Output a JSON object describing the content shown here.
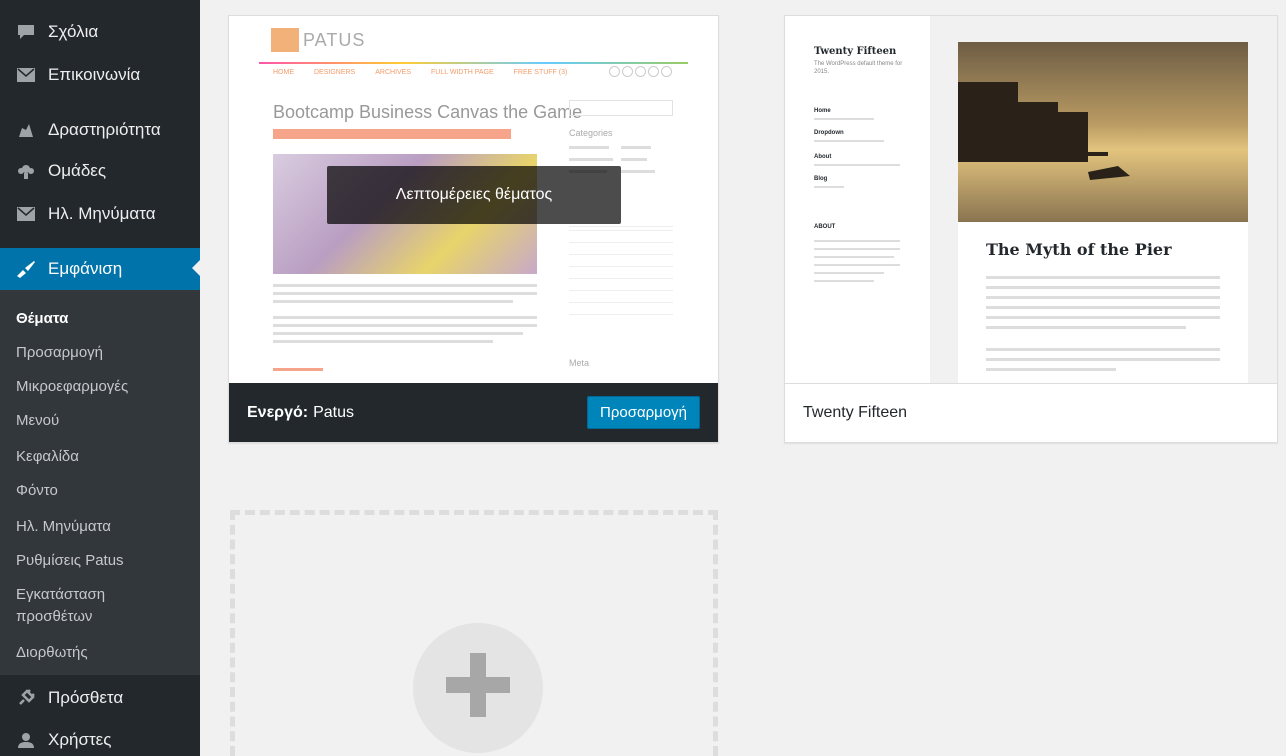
{
  "sidebar": {
    "items": [
      {
        "label": "Σχόλια",
        "icon": "comment-icon"
      },
      {
        "label": "Επικοινωνία",
        "icon": "mail-icon"
      },
      {
        "label": "Δραστηριότητα",
        "icon": "activity-icon"
      },
      {
        "label": "Ομάδες",
        "icon": "groups-icon"
      },
      {
        "label": "Ηλ. Μηνύματα",
        "icon": "mail-icon"
      },
      {
        "label": "Εμφάνιση",
        "icon": "brush-icon",
        "active": true
      },
      {
        "label": "Πρόσθετα",
        "icon": "plugins-icon"
      },
      {
        "label": "Χρήστες",
        "icon": "users-icon"
      }
    ],
    "submenu": [
      "Θέματα",
      "Προσαρμογή",
      "Μικροεφαρμογές",
      "Μενού",
      "Κεφαλίδα",
      "Φόντο",
      "Ηλ. Μηνύματα",
      "Ρυθμίσεις Patus",
      "Εγκατάσταση",
      "προσθέτων",
      "Διορθωτής"
    ]
  },
  "themes": {
    "patus": {
      "active_prefix": "Ενεργό:",
      "name": "Patus",
      "customize_label": "Προσαρμογή",
      "details_label": "Λεπτομέρειες θέματος",
      "preview": {
        "logo": "PATUS",
        "post_title": "Bootcamp Business Canvas the Game",
        "nav": [
          "HOME",
          "DESIGNERS",
          "ARCHIVES",
          "FULL WIDTH PAGE",
          "FREE STUFF (3)"
        ],
        "categories_title": "Categories",
        "meta_title": "Meta"
      }
    },
    "twentyfifteen": {
      "name": "Twenty Fifteen",
      "preview": {
        "site_title": "Twenty Fifteen",
        "tagline": "The WordPress default theme for 2015.",
        "menu": [
          "Home",
          "Dropdown",
          "About",
          "Blog"
        ],
        "about_title": "ABOUT",
        "post_title": "The Myth of the Pier"
      }
    }
  },
  "colors": {
    "accent": "#0073aa",
    "sidebar": "#23282d",
    "submenu": "#32373c"
  }
}
